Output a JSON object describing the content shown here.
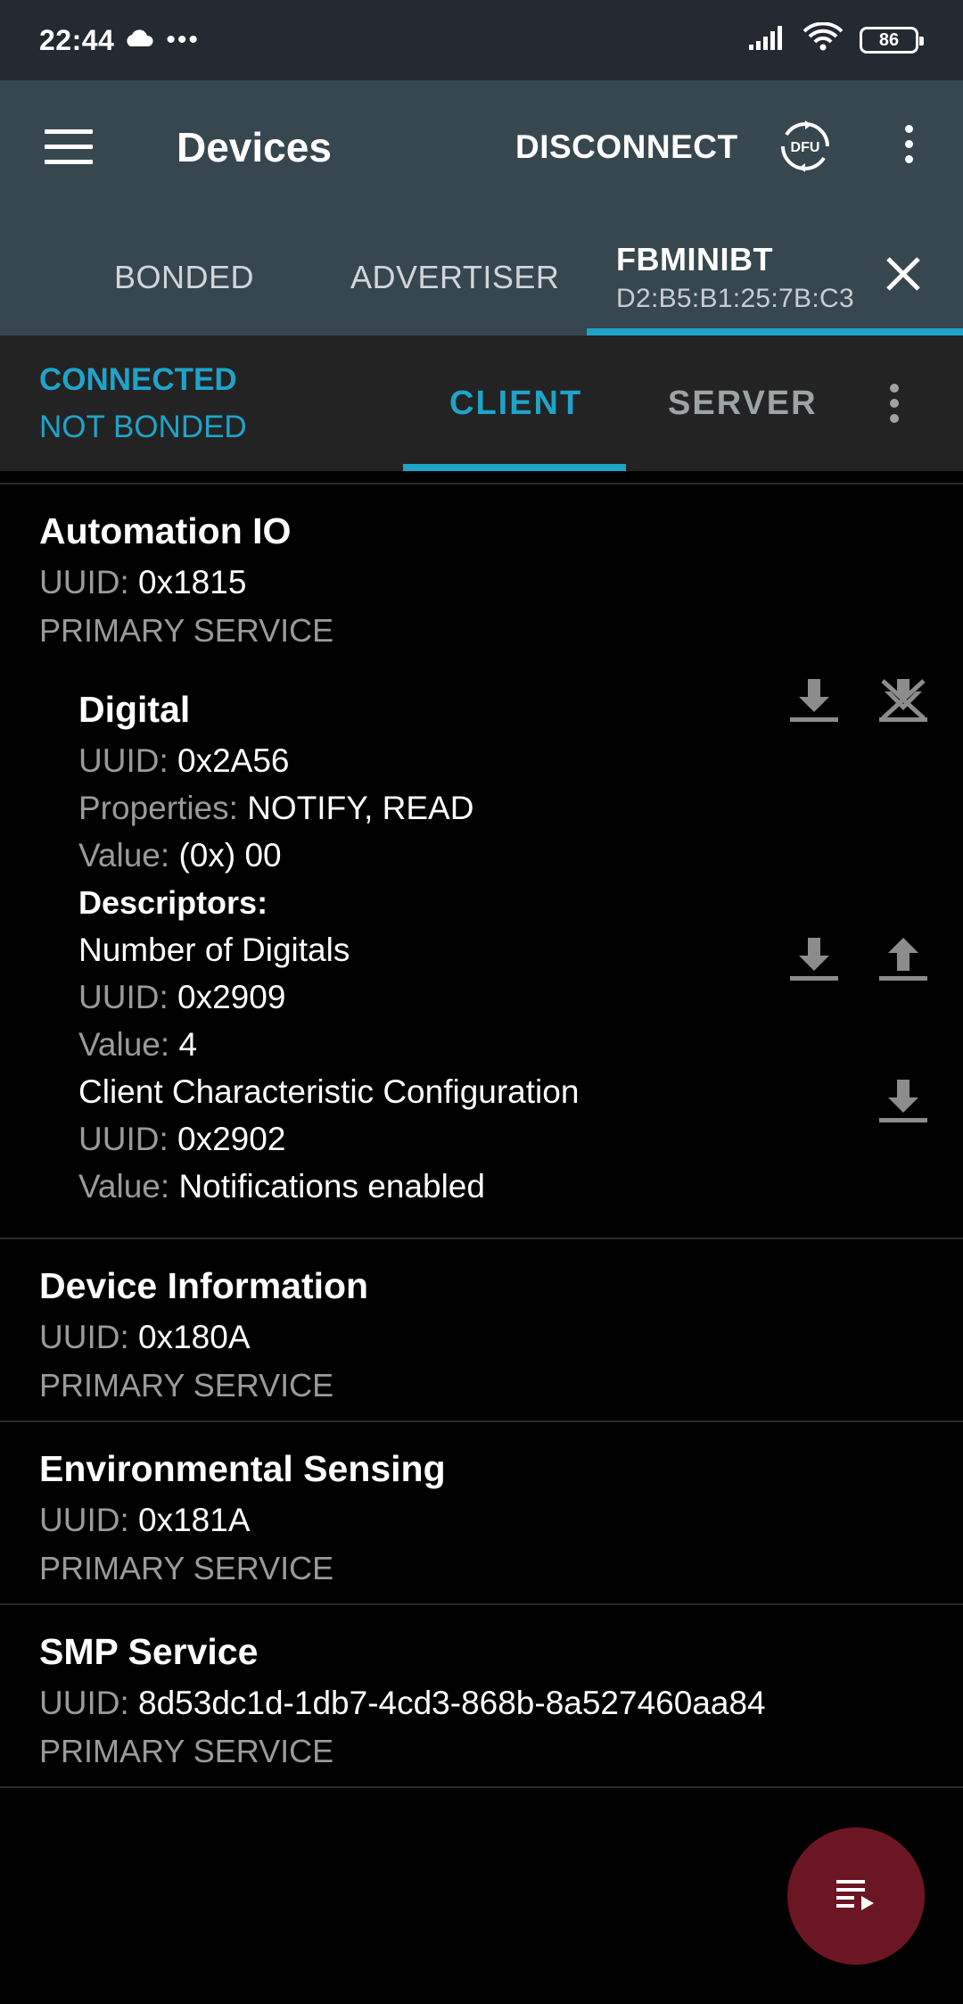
{
  "status_bar": {
    "time": "22:44",
    "battery": "86"
  },
  "app_bar": {
    "title": "Devices",
    "disconnect_label": "DISCONNECT"
  },
  "device_tabs": {
    "items": [
      {
        "label": "BONDED"
      },
      {
        "label": "ADVERTISER"
      }
    ],
    "active": {
      "name": "FBMINIBT",
      "address": "D2:B5:B1:25:7B:C3"
    }
  },
  "connection": {
    "state": "CONNECTED",
    "bond_state": "NOT BONDED",
    "tabs": [
      {
        "label": "CLIENT",
        "selected": true
      },
      {
        "label": "SERVER",
        "selected": false
      }
    ]
  },
  "services": [
    {
      "name": "Automation IO",
      "uuid_label": "UUID:",
      "uuid": "0x1815",
      "type": "PRIMARY SERVICE",
      "characteristics": [
        {
          "name": "Digital",
          "uuid_label": "UUID:",
          "uuid": "0x2A56",
          "properties_label": "Properties:",
          "properties": "NOTIFY, READ",
          "value_label": "Value:",
          "value": "(0x) 00",
          "descriptors_label": "Descriptors:",
          "descriptors": [
            {
              "name": "Number of Digitals",
              "uuid_label": "UUID:",
              "uuid": "0x2909",
              "value_label": "Value:",
              "value": "4"
            },
            {
              "name": "Client Characteristic Configuration",
              "uuid_label": "UUID:",
              "uuid": "0x2902",
              "value_label": "Value:",
              "value": "Notifications enabled"
            }
          ]
        }
      ]
    },
    {
      "name": "Device Information",
      "uuid_label": "UUID:",
      "uuid": "0x180A",
      "type": "PRIMARY SERVICE"
    },
    {
      "name": "Environmental Sensing",
      "uuid_label": "UUID:",
      "uuid": "0x181A",
      "type": "PRIMARY SERVICE"
    },
    {
      "name": "SMP Service",
      "uuid_label": "UUID:",
      "uuid": "8d53dc1d-1db7-4cd3-868b-8a527460aa84",
      "type": "PRIMARY SERVICE"
    }
  ],
  "colors": {
    "status_bar": "#232a31",
    "app_bar": "#37474f",
    "accent": "#1fa3c9",
    "connection_bar": "#232323",
    "fab": "#6b1622",
    "label_gray": "#9a9a9a"
  },
  "icons": {
    "menu": "menu-icon",
    "dfu": "dfu-icon",
    "overflow": "more-vert-icon",
    "close": "close-icon",
    "read": "download-icon",
    "write": "upload-icon",
    "notify_off": "notifications-off-icon",
    "fab": "playlist-play-icon"
  }
}
